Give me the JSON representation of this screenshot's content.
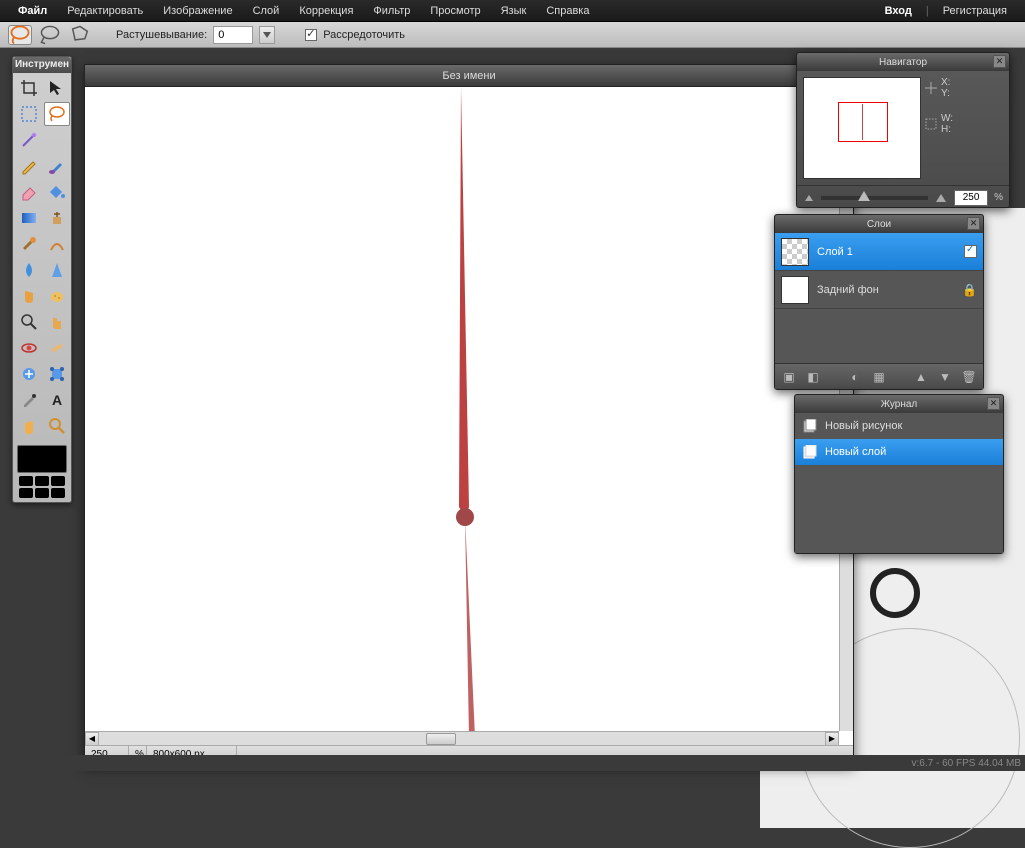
{
  "menu": {
    "items": [
      "Файл",
      "Редактировать",
      "Изображение",
      "Слой",
      "Коррекция",
      "Фильтр",
      "Просмотр",
      "Язык",
      "Справка"
    ],
    "login": "Вход",
    "register": "Регистрация"
  },
  "options": {
    "feather_label": "Растушевывание:",
    "feather_value": "0",
    "spread_label": "Рассредоточить"
  },
  "tools_panel_title": "Инструмен",
  "canvas": {
    "title": "Без имени",
    "zoom": "250",
    "zoom_pct": "%",
    "dimensions": "800x600 px"
  },
  "navigator": {
    "title": "Навигатор",
    "x_label": "X:",
    "y_label": "Y:",
    "w_label": "W:",
    "h_label": "H:",
    "zoom_value": "250",
    "zoom_pct": "%"
  },
  "layers_panel": {
    "title": "Слои",
    "items": [
      {
        "name": "Слой 1",
        "active": true,
        "transparent": true,
        "visible": true,
        "locked": false
      },
      {
        "name": "Задний фон",
        "active": false,
        "transparent": false,
        "visible": true,
        "locked": true
      }
    ]
  },
  "history_panel": {
    "title": "Журнал",
    "items": [
      {
        "label": "Новый рисунок",
        "active": false
      },
      {
        "label": "Новый слой",
        "active": true
      }
    ]
  },
  "footer_status": "v:6.7 - 60 FPS 44.04 MB"
}
